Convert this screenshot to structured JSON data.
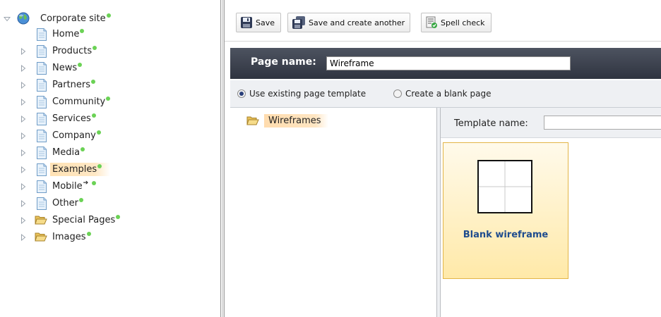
{
  "tree": {
    "root": {
      "label": "Corporate site",
      "expanded": true,
      "published": true
    },
    "items": [
      {
        "label": "Home",
        "icon": "page-icon",
        "expandable": false,
        "published": true,
        "selected": false,
        "linked": false
      },
      {
        "label": "Products",
        "icon": "page-icon",
        "expandable": true,
        "published": true,
        "selected": false,
        "linked": false
      },
      {
        "label": "News",
        "icon": "page-icon",
        "expandable": true,
        "published": true,
        "selected": false,
        "linked": false
      },
      {
        "label": "Partners",
        "icon": "page-icon",
        "expandable": true,
        "published": true,
        "selected": false,
        "linked": false
      },
      {
        "label": "Community",
        "icon": "page-icon",
        "expandable": true,
        "published": true,
        "selected": false,
        "linked": false
      },
      {
        "label": "Services",
        "icon": "page-icon",
        "expandable": true,
        "published": true,
        "selected": false,
        "linked": false
      },
      {
        "label": "Company",
        "icon": "page-icon",
        "expandable": true,
        "published": true,
        "selected": false,
        "linked": false
      },
      {
        "label": "Media",
        "icon": "page-icon",
        "expandable": true,
        "published": true,
        "selected": false,
        "linked": false
      },
      {
        "label": "Examples",
        "icon": "page-icon",
        "expandable": true,
        "published": true,
        "selected": true,
        "linked": false
      },
      {
        "label": "Mobile",
        "icon": "page-icon",
        "expandable": true,
        "published": true,
        "selected": false,
        "linked": true
      },
      {
        "label": "Other",
        "icon": "page-icon",
        "expandable": true,
        "published": true,
        "selected": false,
        "linked": false
      },
      {
        "label": "Special Pages",
        "icon": "folder-icon",
        "expandable": true,
        "published": true,
        "selected": false,
        "linked": false
      },
      {
        "label": "Images",
        "icon": "folder-icon",
        "expandable": true,
        "published": true,
        "selected": false,
        "linked": false
      }
    ]
  },
  "toolbar": {
    "save_label": "Save",
    "save_another_label": "Save and create another",
    "spell_check_label": "Spell check"
  },
  "page": {
    "name_label": "Page name:",
    "name_value": "Wireframe"
  },
  "template_mode": {
    "options": [
      {
        "label": "Use existing page template",
        "selected": true
      },
      {
        "label": "Create a blank page",
        "selected": false
      }
    ]
  },
  "categories": {
    "items": [
      {
        "label": "Wireframes",
        "icon": "folder-open-icon",
        "selected": true
      }
    ]
  },
  "templates": {
    "search_label": "Template name:",
    "search_value": "",
    "items": [
      {
        "label": "Blank wireframe",
        "selected": true
      }
    ]
  },
  "colors": {
    "status_published": "#6bd255",
    "header_bg": "#3d424e",
    "selection": "#ffe2b4",
    "template_title": "#1e4c8e"
  }
}
